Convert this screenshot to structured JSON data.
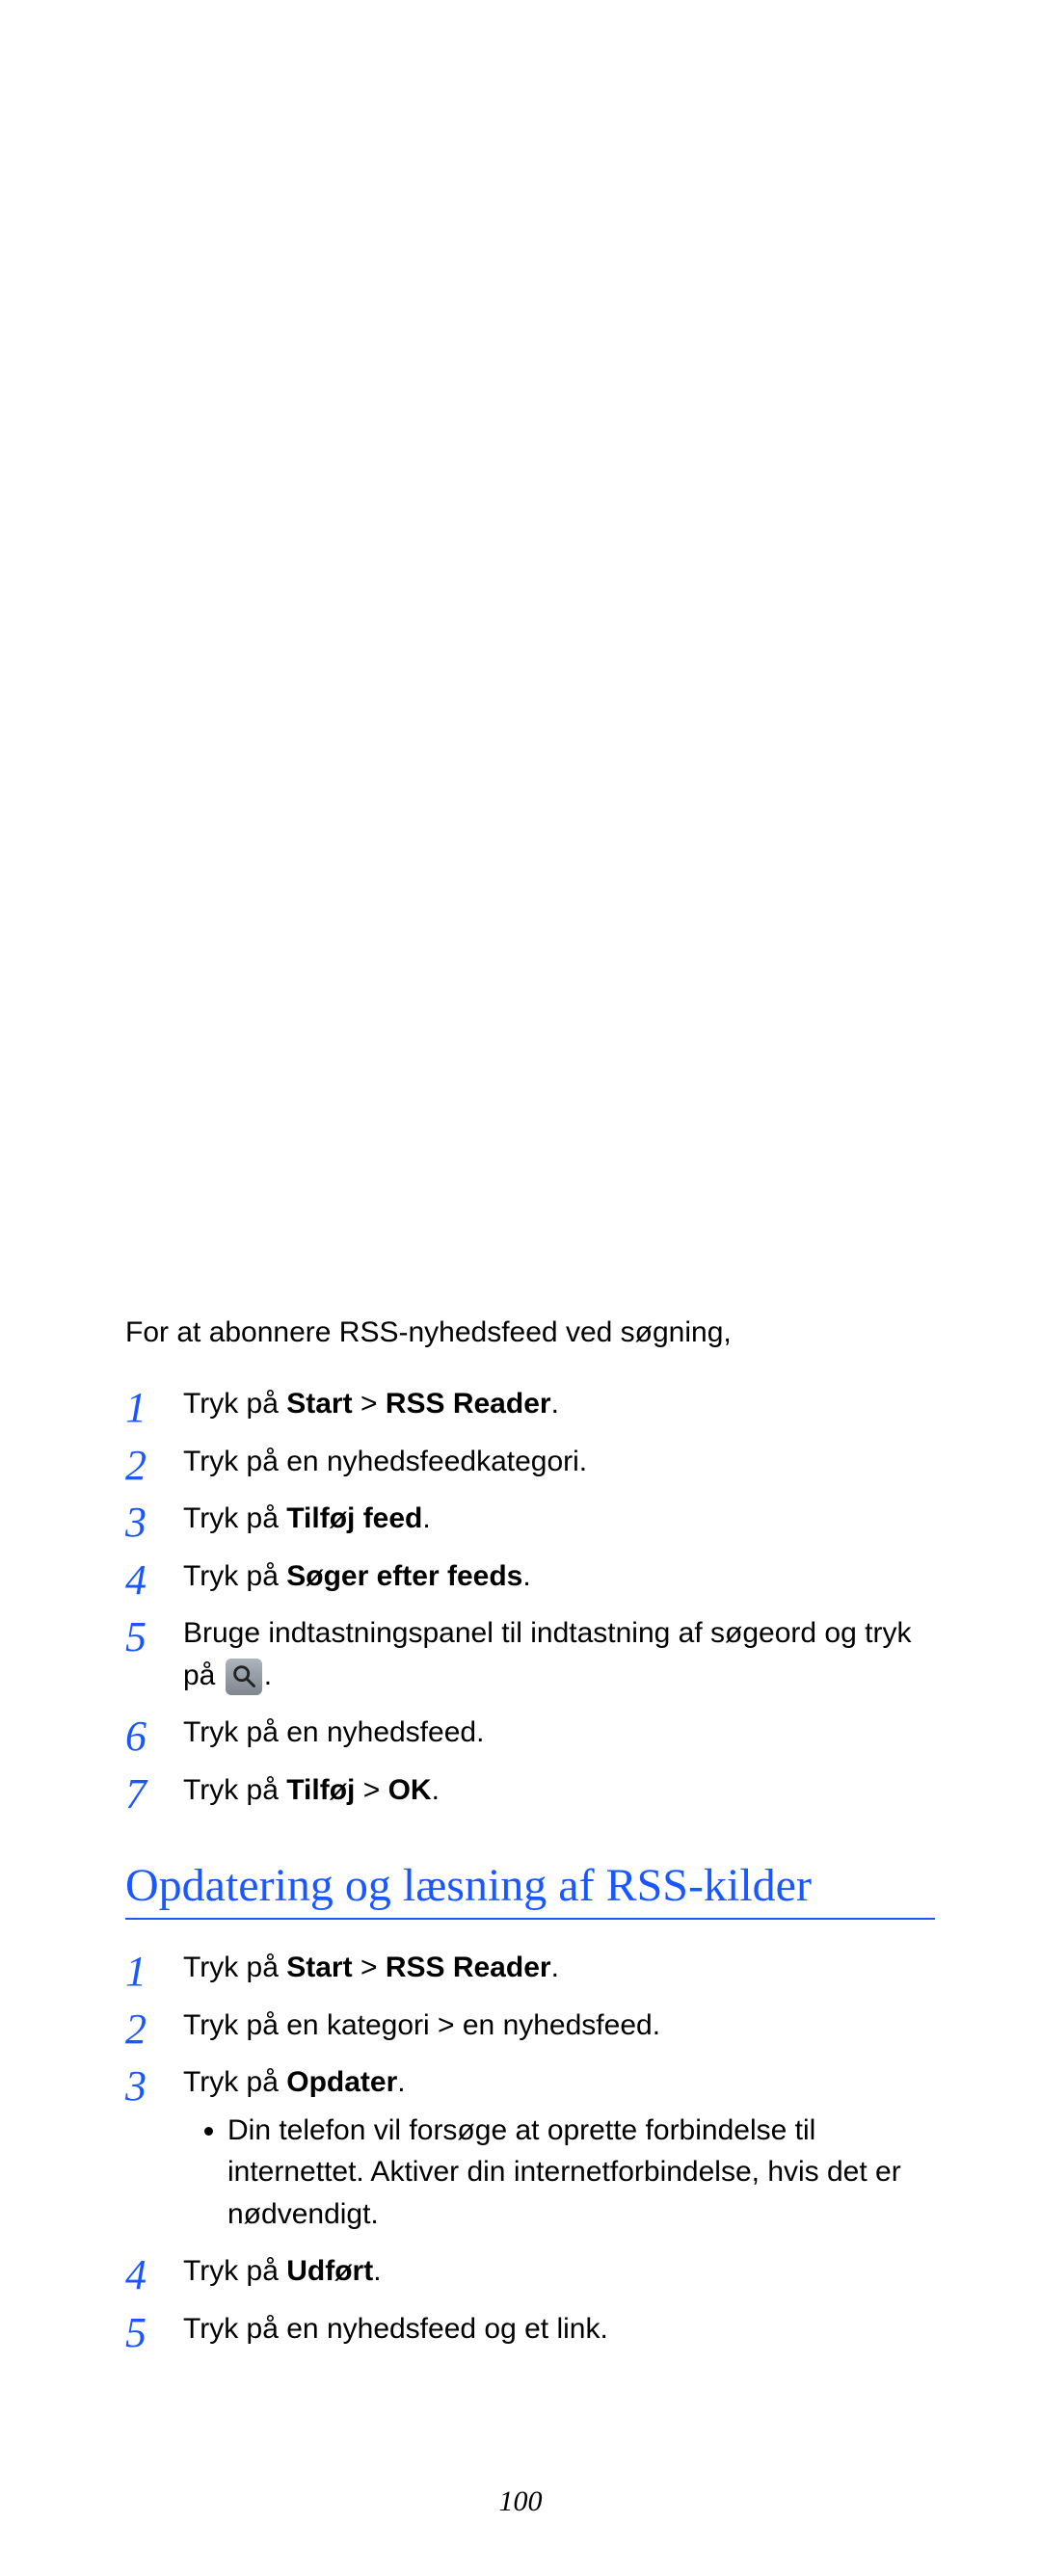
{
  "intro": "For at abonnere RSS-nyhedsfeed ved søgning,",
  "steps_a": [
    {
      "n": "1",
      "segments": [
        {
          "t": "Tryk på ",
          "b": false
        },
        {
          "t": "Start",
          "b": true
        },
        {
          "t": " > ",
          "b": false
        },
        {
          "t": "RSS Reader",
          "b": true
        },
        {
          "t": ".",
          "b": false
        }
      ]
    },
    {
      "n": "2",
      "segments": [
        {
          "t": "Tryk på en nyhedsfeedkategori.",
          "b": false
        }
      ]
    },
    {
      "n": "3",
      "segments": [
        {
          "t": "Tryk på ",
          "b": false
        },
        {
          "t": "Tilføj feed",
          "b": true
        },
        {
          "t": ".",
          "b": false
        }
      ]
    },
    {
      "n": "4",
      "segments": [
        {
          "t": "Tryk på ",
          "b": false
        },
        {
          "t": "Søger efter feeds",
          "b": true
        },
        {
          "t": ".",
          "b": false
        }
      ]
    },
    {
      "n": "5",
      "segments": [
        {
          "t": "Bruge indtastningspanel til indtastning af søgeord og tryk på ",
          "b": false
        },
        {
          "icon": "search"
        },
        {
          "t": ".",
          "b": false
        }
      ]
    },
    {
      "n": "6",
      "segments": [
        {
          "t": "Tryk på en nyhedsfeed.",
          "b": false
        }
      ]
    },
    {
      "n": "7",
      "segments": [
        {
          "t": "Tryk på ",
          "b": false
        },
        {
          "t": "Tilføj",
          "b": true
        },
        {
          "t": " > ",
          "b": false
        },
        {
          "t": "OK",
          "b": true
        },
        {
          "t": ".",
          "b": false
        }
      ]
    }
  ],
  "section_heading": "Opdatering og læsning af RSS-kilder",
  "steps_b": [
    {
      "n": "1",
      "segments": [
        {
          "t": "Tryk på ",
          "b": false
        },
        {
          "t": "Start",
          "b": true
        },
        {
          "t": " > ",
          "b": false
        },
        {
          "t": "RSS Reader",
          "b": true
        },
        {
          "t": ".",
          "b": false
        }
      ]
    },
    {
      "n": "2",
      "segments": [
        {
          "t": "Tryk på en kategori > en nyhedsfeed.",
          "b": false
        }
      ]
    },
    {
      "n": "3",
      "segments": [
        {
          "t": "Tryk på ",
          "b": false
        },
        {
          "t": "Opdater",
          "b": true
        },
        {
          "t": ".",
          "b": false
        }
      ],
      "sub": [
        "Din telefon vil forsøge at oprette forbindelse til internettet. Aktiver din internetforbindelse, hvis det er nødvendigt."
      ]
    },
    {
      "n": "4",
      "segments": [
        {
          "t": "Tryk på ",
          "b": false
        },
        {
          "t": "Udført",
          "b": true
        },
        {
          "t": ".",
          "b": false
        }
      ]
    },
    {
      "n": "5",
      "segments": [
        {
          "t": "Tryk på en nyhedsfeed og et link.",
          "b": false
        }
      ]
    }
  ],
  "page_number": "100"
}
